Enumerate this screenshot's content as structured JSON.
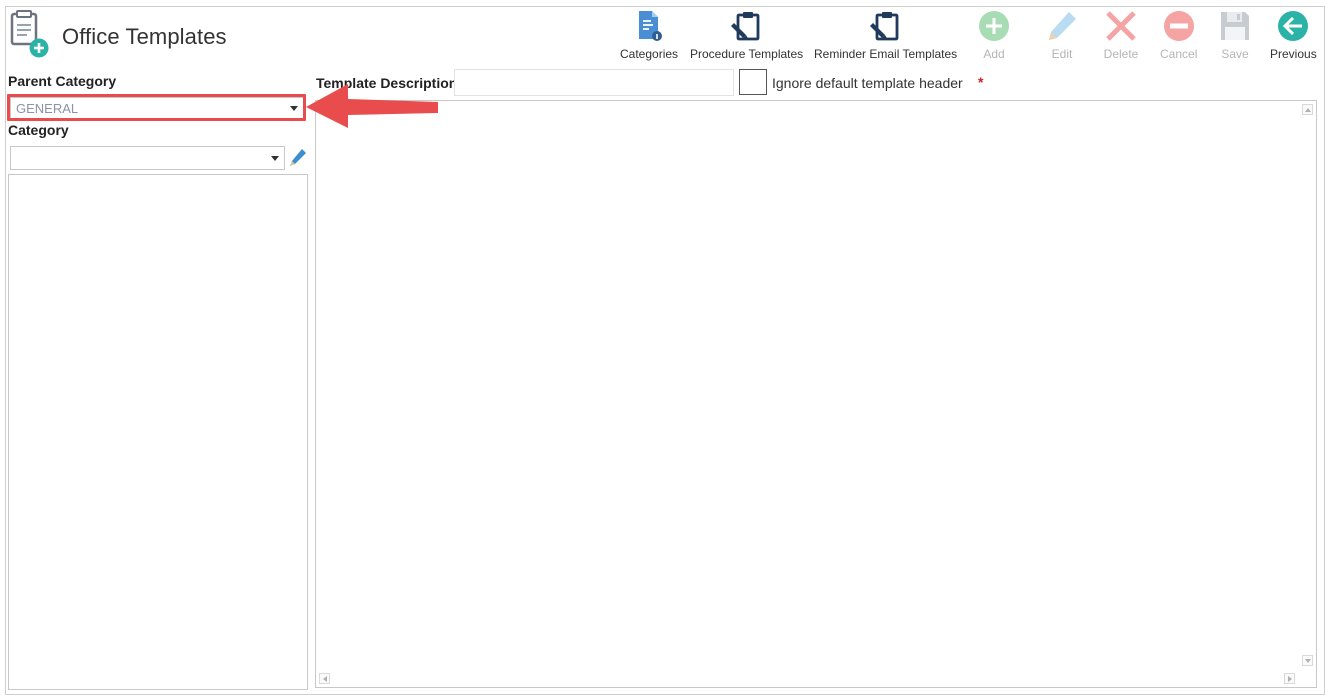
{
  "app": {
    "title": "Office Templates",
    "icon": "document-add-icon"
  },
  "toolbar": [
    {
      "id": "categories",
      "label": "Categories",
      "icon": "document-info-icon",
      "enabled": true
    },
    {
      "id": "procedure_templates",
      "label": "Procedure Templates",
      "icon": "clipboard-pen-icon",
      "enabled": true
    },
    {
      "id": "reminder_email_templates",
      "label": "Reminder Email Templates",
      "icon": "clipboard-pen-icon",
      "enabled": true
    },
    {
      "id": "add",
      "label": "Add",
      "icon": "plus-circle-icon",
      "enabled": false
    },
    {
      "id": "edit",
      "label": "Edit",
      "icon": "pencil-icon",
      "enabled": false
    },
    {
      "id": "delete",
      "label": "Delete",
      "icon": "x-icon",
      "enabled": false
    },
    {
      "id": "cancel",
      "label": "Cancel",
      "icon": "minus-circle-icon",
      "enabled": false
    },
    {
      "id": "save",
      "label": "Save",
      "icon": "floppy-disk-icon",
      "enabled": false
    },
    {
      "id": "previous",
      "label": "Previous",
      "icon": "arrow-left-circle-icon",
      "enabled": true
    }
  ],
  "left_panel": {
    "parent_category": {
      "label": "Parent Category",
      "value": "GENERAL"
    },
    "category": {
      "label": "Category",
      "value": ""
    },
    "category_items": []
  },
  "form": {
    "template_description": {
      "label": "Template Description",
      "value": ""
    },
    "ignore_header": {
      "label": "Ignore default template header",
      "checked": false
    },
    "required_marker": "*"
  },
  "colors": {
    "highlight": "#e84c4c",
    "accent_teal": "#2bb3a8",
    "navy": "#1f3a5a",
    "required": "#d01f1f"
  }
}
